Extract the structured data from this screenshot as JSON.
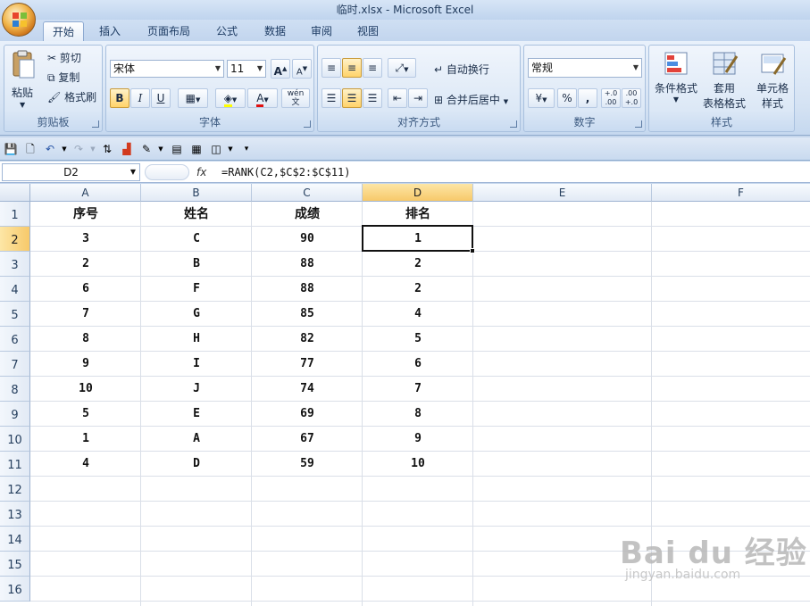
{
  "window": {
    "title": "临时.xlsx - Microsoft Excel"
  },
  "tabs": [
    "开始",
    "插入",
    "页面布局",
    "公式",
    "数据",
    "审阅",
    "视图"
  ],
  "ribbon": {
    "clipboard": {
      "paste": "粘贴",
      "cut": "剪切",
      "copy": "复制",
      "format_painter": "格式刷",
      "label": "剪贴板"
    },
    "font": {
      "name": "宋体",
      "size": "11",
      "label": "字体",
      "bold": "B",
      "italic": "I",
      "underline": "U",
      "grow": "A",
      "shrink": "A",
      "font_color": "A",
      "phonetic": "wén 文"
    },
    "alignment": {
      "wrap": "自动换行",
      "merge": "合并后居中",
      "label": "对齐方式"
    },
    "number": {
      "format": "常规",
      "percent": "%",
      "comma": ",",
      "inc_decimal": "+.0 .00",
      "dec_decimal": ".00 +.0",
      "label": "数字"
    },
    "styles": {
      "conditional": "条件格式",
      "table_format_line1": "套用",
      "table_format_line2": "表格格式",
      "cell_styles_line1": "单元格",
      "cell_styles_line2": "样式",
      "label": "样式"
    }
  },
  "formula_bar": {
    "name_box": "D2",
    "fx": "fx",
    "formula": "=RANK(C2,$C$2:$C$11)"
  },
  "columns": [
    "A",
    "B",
    "C",
    "D",
    "E",
    "F"
  ],
  "rows": [
    "1",
    "2",
    "3",
    "4",
    "5",
    "6",
    "7",
    "8",
    "9",
    "10",
    "11",
    "12",
    "13",
    "14",
    "15",
    "16"
  ],
  "cells": [
    [
      "序号",
      "姓名",
      "成绩",
      "排名"
    ],
    [
      "3",
      "C",
      "90",
      "1"
    ],
    [
      "2",
      "B",
      "88",
      "2"
    ],
    [
      "6",
      "F",
      "88",
      "2"
    ],
    [
      "7",
      "G",
      "85",
      "4"
    ],
    [
      "8",
      "H",
      "82",
      "5"
    ],
    [
      "9",
      "I",
      "77",
      "6"
    ],
    [
      "10",
      "J",
      "74",
      "7"
    ],
    [
      "5",
      "E",
      "69",
      "8"
    ],
    [
      "1",
      "A",
      "67",
      "9"
    ],
    [
      "4",
      "D",
      "59",
      "10"
    ]
  ],
  "watermark": {
    "main": "Bai du 经验",
    "sub": "jingyan.baidu.com"
  },
  "colors": {
    "accent": "#f7c96a",
    "ribbon": "#d4e2f3"
  }
}
